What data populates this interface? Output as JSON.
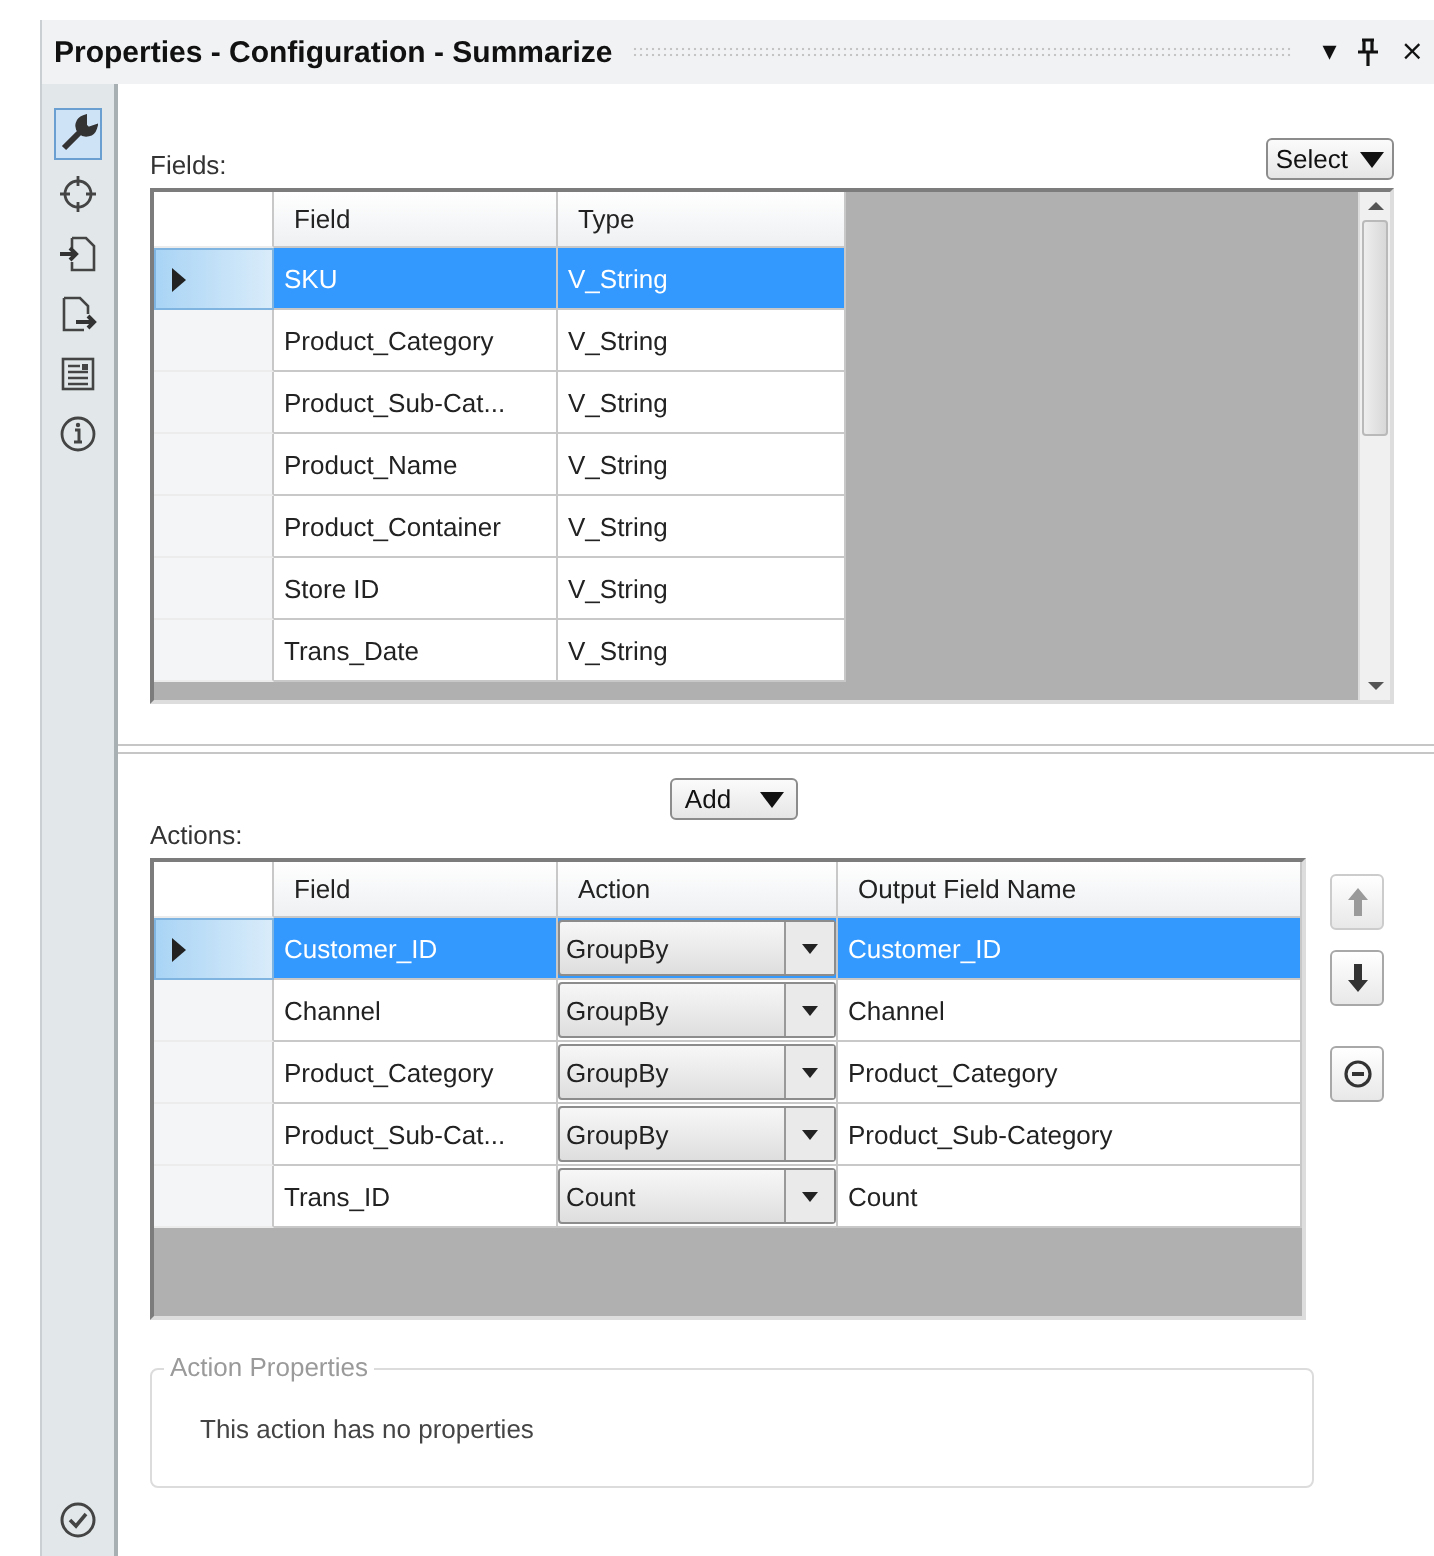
{
  "window": {
    "title": "Properties - Configuration - Summarize",
    "controls": [
      "▾",
      "×"
    ]
  },
  "sidebar": {
    "items": [
      {
        "kind": "wrench",
        "selected": true
      },
      {
        "kind": "crosshair",
        "selected": false
      },
      {
        "kind": "import",
        "selected": false
      },
      {
        "kind": "export",
        "selected": false
      },
      {
        "kind": "document",
        "selected": false
      },
      {
        "kind": "info",
        "selected": false
      }
    ],
    "footer": {
      "kind": "check"
    }
  },
  "fields": {
    "label": "Fields:",
    "select_button": "Select",
    "columns": [
      "Field",
      "Type"
    ],
    "rows": [
      {
        "field": "SKU",
        "type": "V_String",
        "selected": true
      },
      {
        "field": "Product_Category",
        "type": "V_String",
        "selected": false
      },
      {
        "field": "Product_Sub-Cat...",
        "type": "V_String",
        "selected": false
      },
      {
        "field": "Product_Name",
        "type": "V_String",
        "selected": false
      },
      {
        "field": "Product_Container",
        "type": "V_String",
        "selected": false
      },
      {
        "field": "Store ID",
        "type": "V_String",
        "selected": false
      },
      {
        "field": "Trans_Date",
        "type": "V_String",
        "selected": false
      }
    ]
  },
  "actions": {
    "add_button": "Add",
    "label": "Actions:",
    "columns": [
      "Field",
      "Action",
      "Output Field Name"
    ],
    "rows": [
      {
        "field": "Customer_ID",
        "action": "GroupBy",
        "output": "Customer_ID",
        "selected": true
      },
      {
        "field": "Channel",
        "action": "GroupBy",
        "output": "Channel",
        "selected": false
      },
      {
        "field": "Product_Category",
        "action": "GroupBy",
        "output": "Product_Category",
        "selected": false
      },
      {
        "field": "Product_Sub-Cat...",
        "action": "GroupBy",
        "output": "Product_Sub-Category",
        "selected": false
      },
      {
        "field": "Trans_ID",
        "action": "Count",
        "output": "Count",
        "selected": false
      }
    ],
    "side_buttons": [
      {
        "kind": "up"
      },
      {
        "kind": "down"
      },
      {
        "kind": "remove"
      }
    ]
  },
  "action_properties": {
    "title": "Action Properties",
    "message": "This action has no properties"
  }
}
